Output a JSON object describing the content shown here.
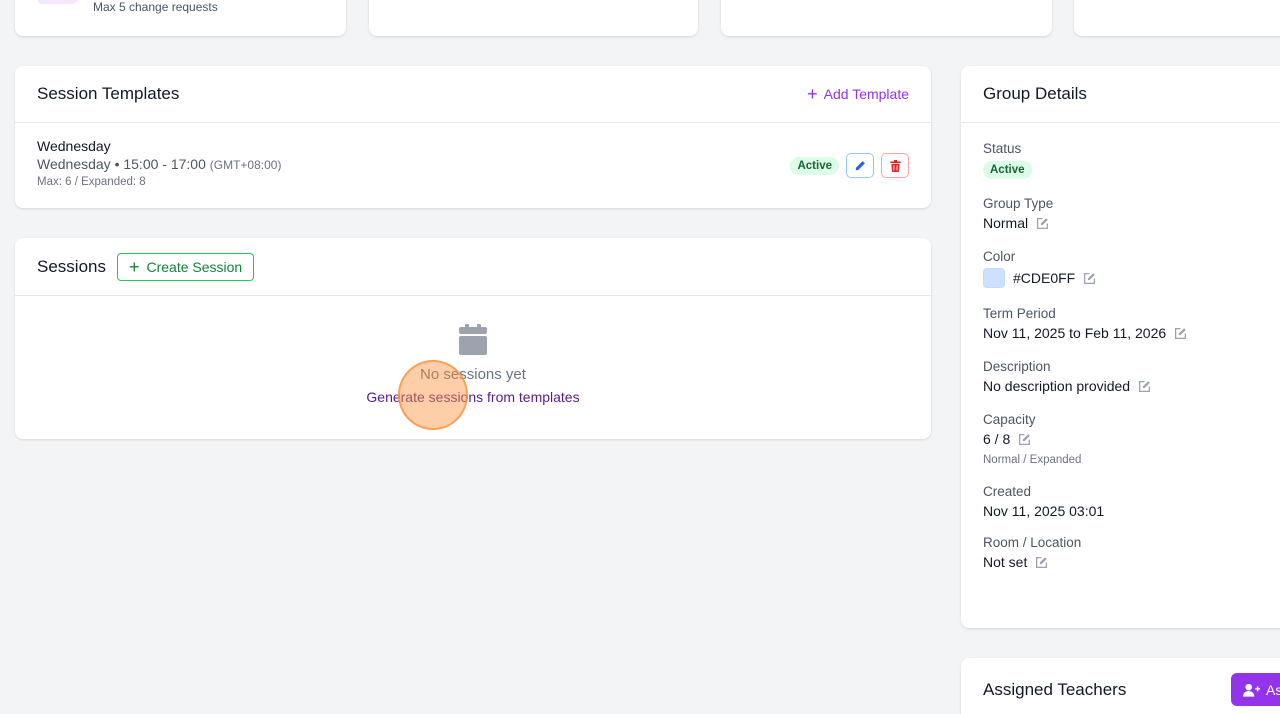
{
  "top_cards": {
    "first": {
      "max_text": "Max 5 change requests"
    }
  },
  "session_templates": {
    "title": "Session Templates",
    "add_label": "Add Template",
    "templates": [
      {
        "name": "Wednesday",
        "schedule": "Wednesday • 15:00 - 17:00",
        "timezone": "(GMT+08:00)",
        "capacity": "Max: 6 / Expanded: 8",
        "status": "Active"
      }
    ]
  },
  "sessions": {
    "title": "Sessions",
    "create_label": "Create Session",
    "empty_title": "No sessions yet",
    "empty_link": "Generate sessions from templates"
  },
  "group_details": {
    "title": "Group Details",
    "status_label": "Status",
    "status_value": "Active",
    "group_type_label": "Group Type",
    "group_type_value": "Normal",
    "color_label": "Color",
    "color_value": "#CDE0FF",
    "term_label": "Term Period",
    "term_value": "Nov 11, 2025 to Feb 11, 2026",
    "description_label": "Description",
    "description_value": "No description provided",
    "capacity_label": "Capacity",
    "capacity_value": "6 / 8",
    "capacity_sub": "Normal / Expanded",
    "created_label": "Created",
    "created_value": "Nov 11, 2025 03:01",
    "room_label": "Room / Location",
    "room_value": "Not set"
  },
  "assigned_teachers": {
    "title": "Assigned Teachers",
    "assign_label": "As"
  },
  "colors": {
    "accent_purple": "#9333ea",
    "success_green": "#15803d",
    "active_badge_bg": "#dcfce7",
    "swatch": "#CDE0FF"
  }
}
